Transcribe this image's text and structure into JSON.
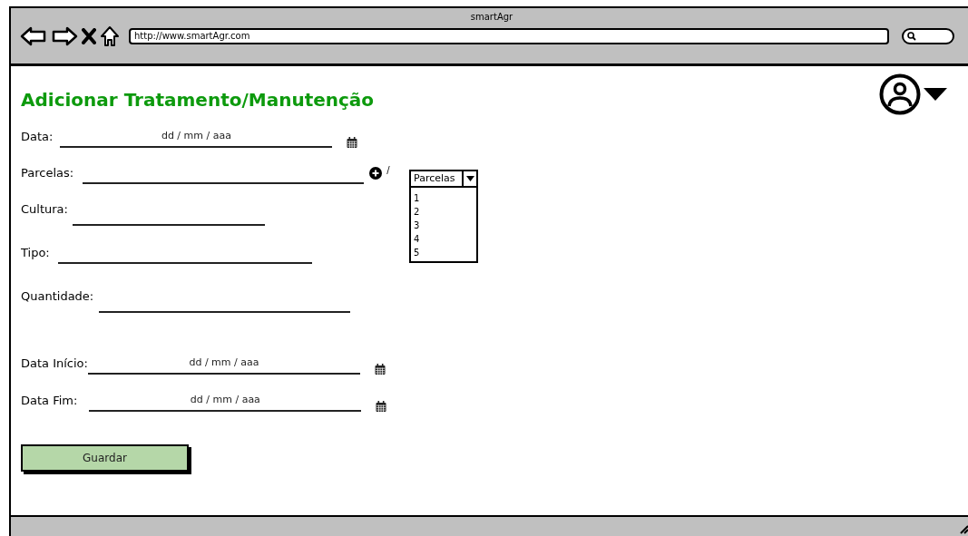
{
  "window": {
    "title": "smartAgr",
    "url": "http://www.smartAgr.com"
  },
  "page": {
    "heading": "Adicionar Tratamento/Manutenção"
  },
  "fields": [
    {
      "kind": "date",
      "label": "Data:",
      "placeholder": "dd / mm / aaa"
    },
    {
      "kind": "picker",
      "label": "Parcelas:",
      "separator": "/"
    },
    {
      "kind": "text",
      "label": "Cultura:"
    },
    {
      "kind": "text",
      "label": "Tipo:"
    },
    {
      "kind": "text",
      "label": "Quantidade:"
    },
    {
      "kind": "date",
      "label": "Data Início:",
      "placeholder": "dd / mm / aaa"
    },
    {
      "kind": "date",
      "label": "Data Fim:",
      "placeholder": "dd / mm / aaa"
    }
  ],
  "dropdown": {
    "label": "Parcelas",
    "expanded": true,
    "options": [
      "1",
      "2",
      "3",
      "4",
      "5"
    ]
  },
  "save_button": {
    "label": "Guardar"
  }
}
